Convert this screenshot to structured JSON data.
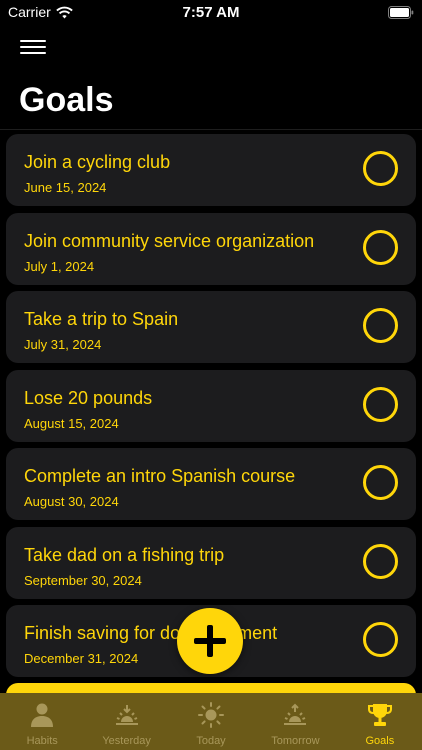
{
  "status_bar": {
    "carrier": "Carrier",
    "time": "7:57 AM"
  },
  "header": {
    "title": "Goals",
    "menu_icon": "hamburger-menu-icon"
  },
  "goals": [
    {
      "title": "Join a cycling club",
      "date": "June 15, 2024",
      "completed": false
    },
    {
      "title": "Join community service organization",
      "date": "July 1, 2024",
      "completed": false
    },
    {
      "title": "Take a trip to Spain",
      "date": "July 31, 2024",
      "completed": false
    },
    {
      "title": "Lose 20 pounds",
      "date": "August 15, 2024",
      "completed": false
    },
    {
      "title": "Complete an intro Spanish course",
      "date": "August 30, 2024",
      "completed": false
    },
    {
      "title": "Take dad on a fishing trip",
      "date": "September 30, 2024",
      "completed": false
    },
    {
      "title": "Finish saving for down payment",
      "date": "December 31, 2024",
      "completed": false
    }
  ],
  "fab": {
    "icon": "plus-icon"
  },
  "tabs": [
    {
      "label": "Habits",
      "icon": "person-icon",
      "active": false
    },
    {
      "label": "Yesterday",
      "icon": "sunset-icon",
      "active": false
    },
    {
      "label": "Today",
      "icon": "sun-icon",
      "active": false
    },
    {
      "label": "Tomorrow",
      "icon": "sunrise-icon",
      "active": false
    },
    {
      "label": "Goals",
      "icon": "trophy-icon",
      "active": true
    }
  ],
  "colors": {
    "accent": "#FFD60A",
    "background": "#000000",
    "card": "#1C1C1E",
    "tab_bar": "#6B5A18",
    "tab_inactive": "#A8975A"
  }
}
